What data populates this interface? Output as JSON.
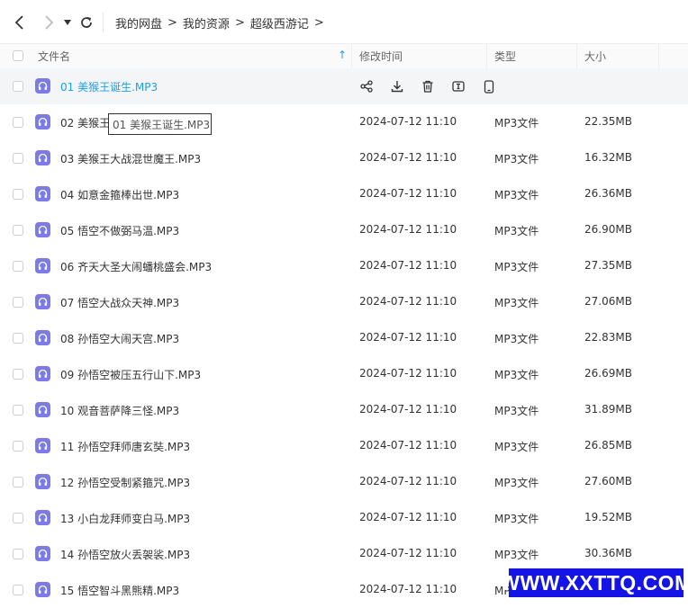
{
  "breadcrumb": [
    "我的网盘",
    "我的资源",
    "超级西游记"
  ],
  "header": {
    "name": "文件名",
    "sort_indicator": "↑",
    "time": "修改时间",
    "type": "类型",
    "size": "大小"
  },
  "hover_actions": [
    "share-icon",
    "download-icon",
    "delete-icon",
    "rename-icon",
    "phone-icon"
  ],
  "highlight_color": "#1f9fe6",
  "file_icon_color": "#7b7be8",
  "tooltip": "01 美猴王诞生.MP3",
  "watermark": "WWW.XXTTQ.COM",
  "files": [
    {
      "name": "01 美猴王诞生.MP3",
      "time": "",
      "type": "",
      "size": ""
    },
    {
      "name": "02 美猴王",
      "time": "2024-07-12 11:10",
      "type": "MP3文件",
      "size": "22.35MB"
    },
    {
      "name": "03 美猴王大战混世魔王.MP3",
      "time": "2024-07-12 11:10",
      "type": "MP3文件",
      "size": "16.32MB"
    },
    {
      "name": "04 如意金箍棒出世.MP3",
      "time": "2024-07-12 11:10",
      "type": "MP3文件",
      "size": "26.36MB"
    },
    {
      "name": "05 悟空不做弼马温.MP3",
      "time": "2024-07-12 11:10",
      "type": "MP3文件",
      "size": "26.90MB"
    },
    {
      "name": "06 齐天大圣大闹蟠桃盛会.MP3",
      "time": "2024-07-12 11:10",
      "type": "MP3文件",
      "size": "27.35MB"
    },
    {
      "name": "07 悟空大战众天神.MP3",
      "time": "2024-07-12 11:10",
      "type": "MP3文件",
      "size": "27.06MB"
    },
    {
      "name": "08 孙悟空大闹天宫.MP3",
      "time": "2024-07-12 11:10",
      "type": "MP3文件",
      "size": "22.83MB"
    },
    {
      "name": "09 孙悟空被压五行山下.MP3",
      "time": "2024-07-12 11:10",
      "type": "MP3文件",
      "size": "26.69MB"
    },
    {
      "name": "10 观音菩萨降三怪.MP3",
      "time": "2024-07-12 11:10",
      "type": "MP3文件",
      "size": "31.89MB"
    },
    {
      "name": "11 孙悟空拜师唐玄奘.MP3",
      "time": "2024-07-12 11:10",
      "type": "MP3文件",
      "size": "26.85MB"
    },
    {
      "name": "12 孙悟空受制紧箍咒.MP3",
      "time": "2024-07-12 11:10",
      "type": "MP3文件",
      "size": "27.60MB"
    },
    {
      "name": "13 小白龙拜师变白马.MP3",
      "time": "2024-07-12 11:10",
      "type": "MP3文件",
      "size": "19.52MB"
    },
    {
      "name": "14 孙悟空放火丢袈裟.MP3",
      "time": "2024-07-12 11:10",
      "type": "MP3文件",
      "size": "30.36MB"
    },
    {
      "name": "15 悟空智斗黑熊精.MP3",
      "time": "2024-07-12 11:10",
      "type": "MP3文件",
      "size": ""
    }
  ]
}
